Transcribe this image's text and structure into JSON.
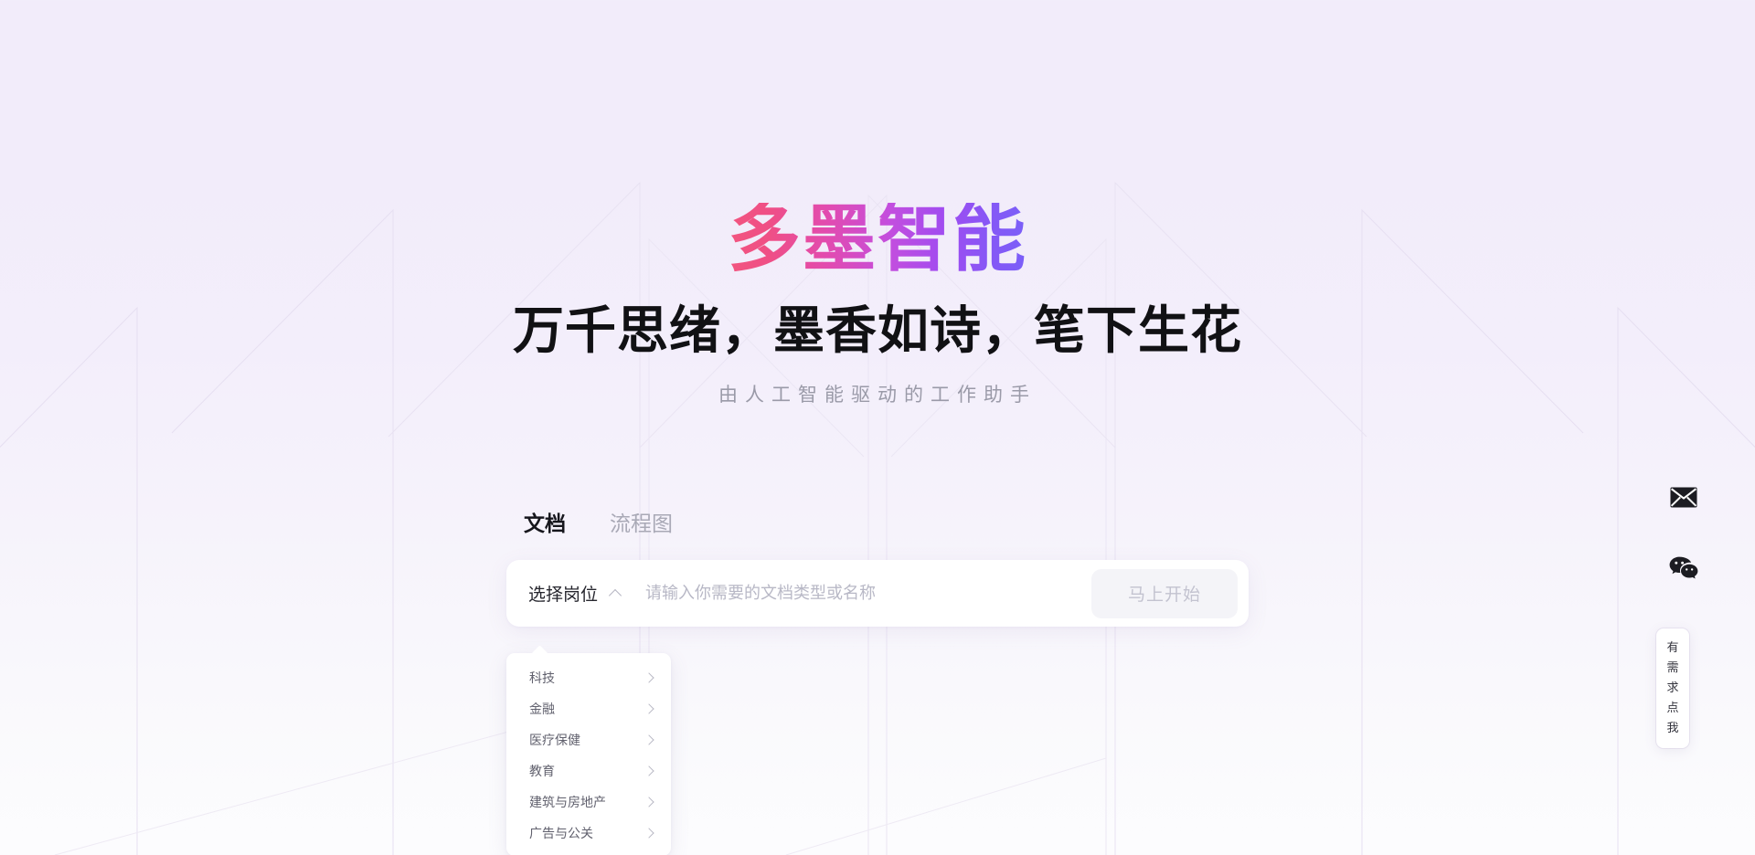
{
  "theme": {
    "bg_top": "#f2ecfa",
    "bg_bottom": "#fcfcfe",
    "brand_gradient_from": "#f2557f",
    "brand_gradient_mid": "#c34ede",
    "brand_gradient_to": "#7a5ff8",
    "line_color": "#e4dcef"
  },
  "hero": {
    "brand_title": "多墨智能",
    "headline": "万千思绪，墨香如诗，笔下生花",
    "tagline": "由人工智能驱动的工作助手"
  },
  "tabs": [
    {
      "label": "文档",
      "active": true
    },
    {
      "label": "流程图",
      "active": false
    }
  ],
  "search": {
    "job_select_label": "选择岗位",
    "chevron_icon": "chevron-up-icon",
    "placeholder": "请输入你需要的文档类型或名称",
    "value": "",
    "start_button": "马上开始"
  },
  "dropdown": {
    "open": true,
    "items": [
      {
        "label": "科技",
        "chevron": "chevron-right-icon"
      },
      {
        "label": "金融",
        "chevron": "chevron-right-icon"
      },
      {
        "label": "医疗保健",
        "chevron": "chevron-right-icon"
      },
      {
        "label": "教育",
        "chevron": "chevron-right-icon"
      },
      {
        "label": "建筑与房地产",
        "chevron": "chevron-right-icon"
      },
      {
        "label": "广告与公关",
        "chevron": "chevron-right-icon"
      }
    ]
  },
  "rail": {
    "mail_icon": "envelope-icon",
    "wechat_icon": "wechat-icon",
    "cta_chars": [
      "有",
      "需",
      "求",
      "点",
      "我"
    ]
  }
}
